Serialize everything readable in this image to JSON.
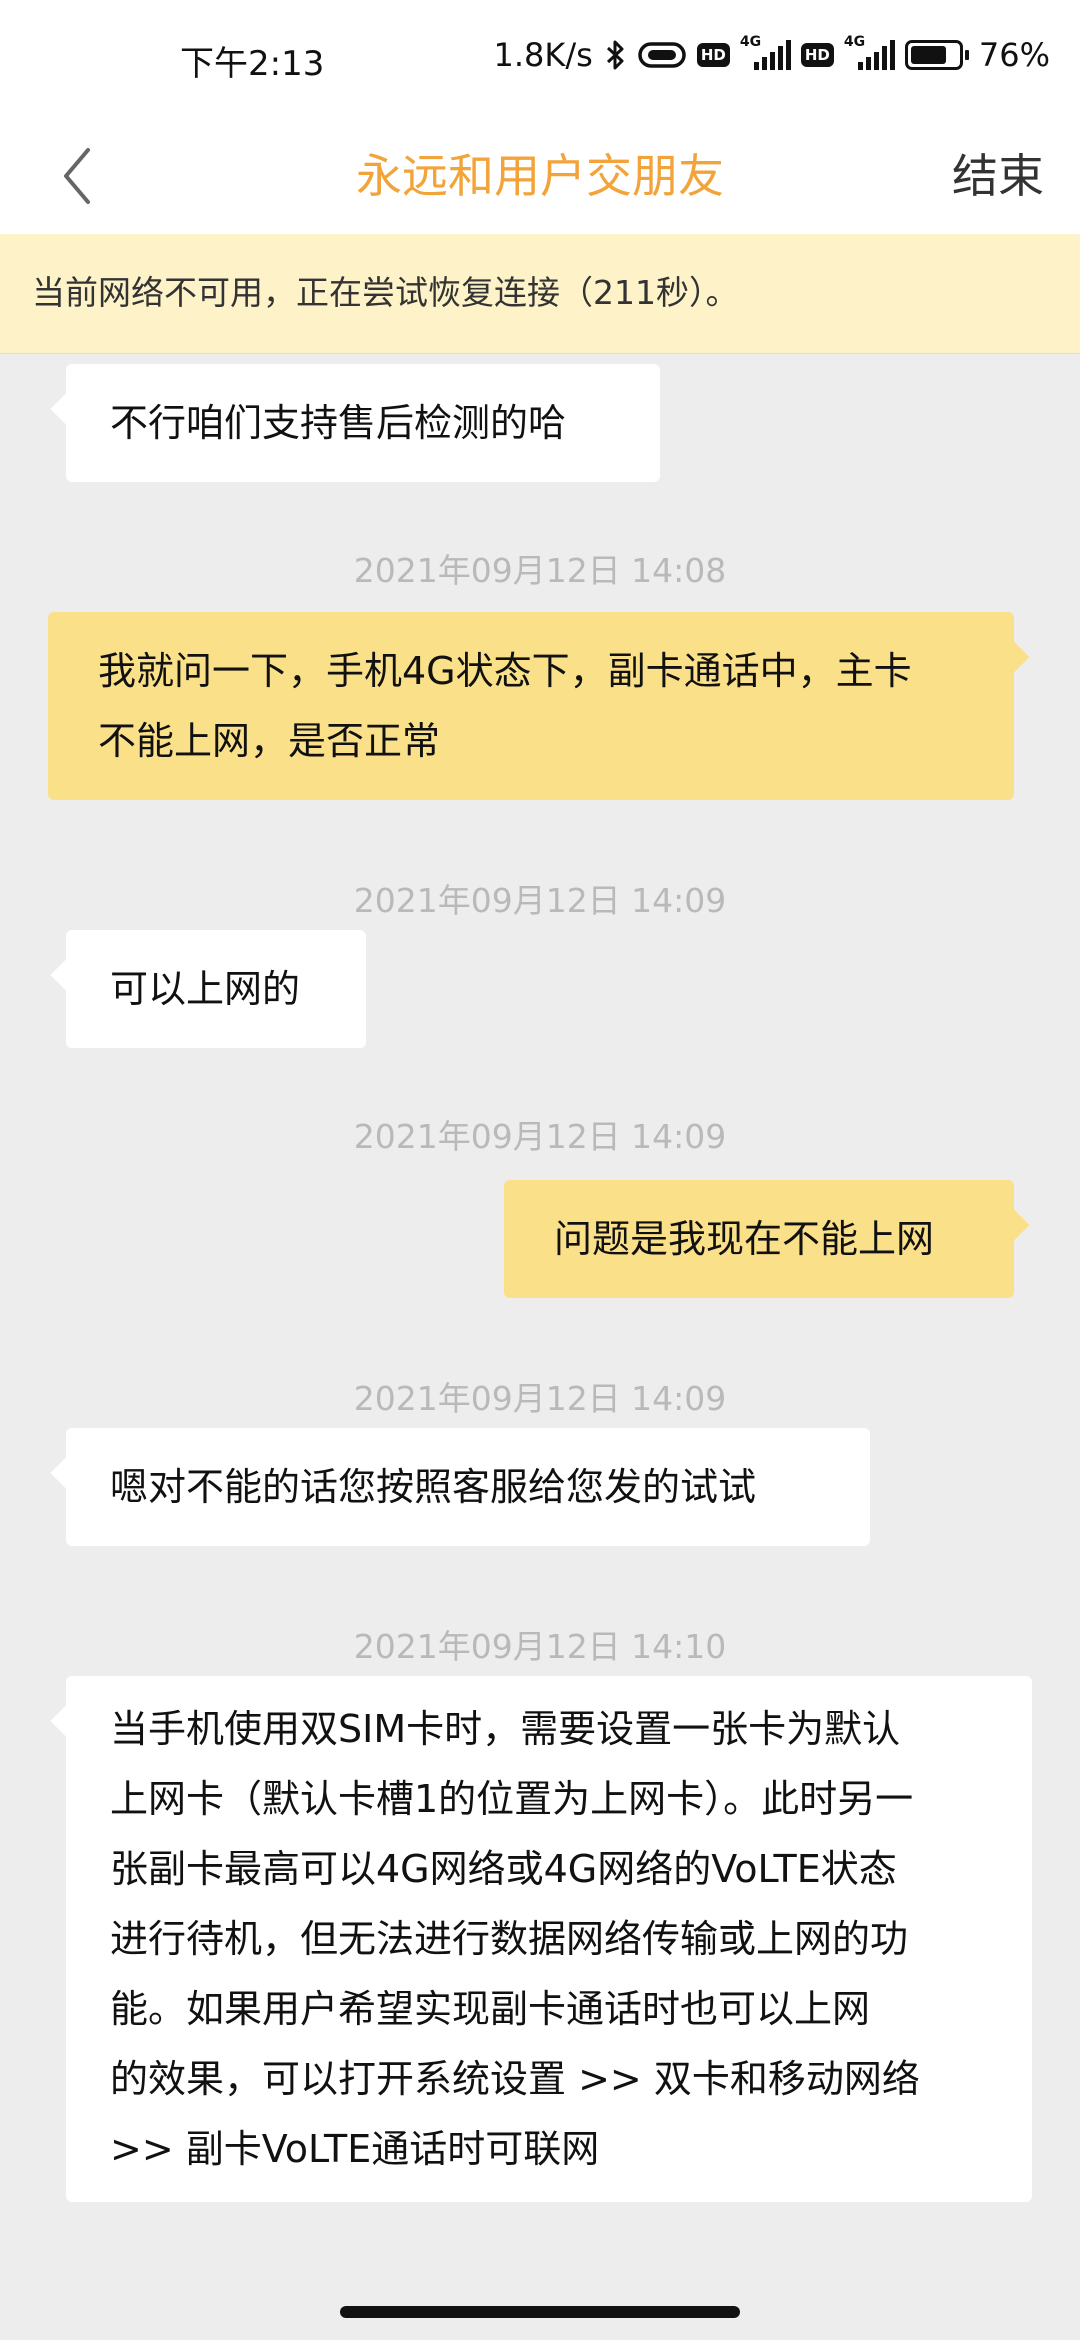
{
  "status_bar": {
    "time": "下午2:13",
    "net_speed": "1.8K/s",
    "battery": "76%",
    "battery_level": 0.76,
    "signal_label": "4G",
    "hd_label": "HD",
    "icons": [
      "bluetooth-icon",
      "vibrate-icon",
      "hd-icon",
      "signal-4g-icon",
      "hd-icon",
      "signal-4g-icon",
      "battery-icon"
    ]
  },
  "header": {
    "title": "永远和用户交朋友",
    "end_label": "结束",
    "back_icon": "chevron-left-icon"
  },
  "banner": {
    "text": "当前网络不可用，正在尝试恢复连接（211秒）。"
  },
  "messages": [
    {
      "sender": "agent",
      "text": "不行咱们支持售后检测的哈"
    },
    {
      "timestamp": "2021年09月12日 14:08"
    },
    {
      "sender": "user",
      "text": "我就问一下，手机4G状态下，副卡通话中，主卡\n不能上网，是否正常"
    },
    {
      "timestamp": "2021年09月12日 14:09"
    },
    {
      "sender": "agent",
      "text": "可以上网的"
    },
    {
      "timestamp": "2021年09月12日 14:09"
    },
    {
      "sender": "user",
      "text": "问题是我现在不能上网"
    },
    {
      "timestamp": "2021年09月12日 14:09"
    },
    {
      "sender": "agent",
      "text": "嗯对不能的话您按照客服给您发的试试"
    },
    {
      "timestamp": "2021年09月12日 14:10"
    },
    {
      "sender": "agent",
      "text": "当手机使用双SIM卡时，需要设置一张卡为默认\n上网卡（默认卡槽1的位置为上网卡）。此时另一\n张副卡最高可以4G网络或4G网络的VoLTE状态\n进行待机，但无法进行数据网络传输或上网的功\n能。如果用户希望实现副卡通话时也可以上网\n的效果，可以打开系统设置 >> 双卡和移动网络\n>> 副卡VoLTE通话时可联网"
    }
  ],
  "colors": {
    "accent": "#f2a33a",
    "user_bubble": "#fbe08a",
    "agent_bubble": "#ffffff",
    "banner_bg": "#fdf2c8",
    "chat_bg": "#ededed",
    "timestamp": "#b9b9b9"
  }
}
